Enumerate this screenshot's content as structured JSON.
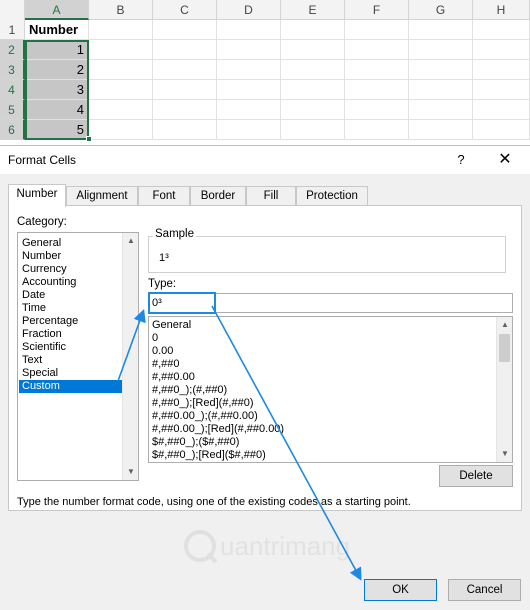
{
  "spreadsheet": {
    "columns": [
      "A",
      "B",
      "C",
      "D",
      "E",
      "F",
      "G",
      "H"
    ],
    "rows": [
      {
        "row": "1",
        "a": "Number"
      },
      {
        "row": "2",
        "a": "1"
      },
      {
        "row": "3",
        "a": "2"
      },
      {
        "row": "4",
        "a": "3"
      },
      {
        "row": "5",
        "a": "4"
      },
      {
        "row": "6",
        "a": "5"
      }
    ]
  },
  "dialog": {
    "title": "Format Cells",
    "help": "?",
    "close": "✕",
    "tabs": [
      "Number",
      "Alignment",
      "Font",
      "Border",
      "Fill",
      "Protection"
    ],
    "active_tab": "Number",
    "category_label": "Category:",
    "categories": [
      "General",
      "Number",
      "Currency",
      "Accounting",
      "Date",
      "Time",
      "Percentage",
      "Fraction",
      "Scientific",
      "Text",
      "Special",
      "Custom"
    ],
    "selected_category": "Custom",
    "sample_label": "Sample",
    "sample_value": "1³",
    "type_label": "Type:",
    "type_value": "0³",
    "format_codes": [
      "General",
      "0",
      "0.00",
      "#,##0",
      "#,##0.00",
      "#,##0_);(#,##0)",
      "#,##0_);[Red](#,##0)",
      "#,##0.00_);(#,##0.00)",
      "#,##0.00_);[Red](#,##0.00)",
      "$#,##0_);($#,##0)",
      "$#,##0_);[Red]($#,##0)"
    ],
    "delete_label": "Delete",
    "hint": "Type the number format code, using one of the existing codes as a starting point.",
    "ok_label": "OK",
    "cancel_label": "Cancel"
  },
  "watermark": "uantrimang",
  "colors": {
    "accent": "#0078d7",
    "arrow": "#1e88e5",
    "excel_green": "#217346"
  }
}
